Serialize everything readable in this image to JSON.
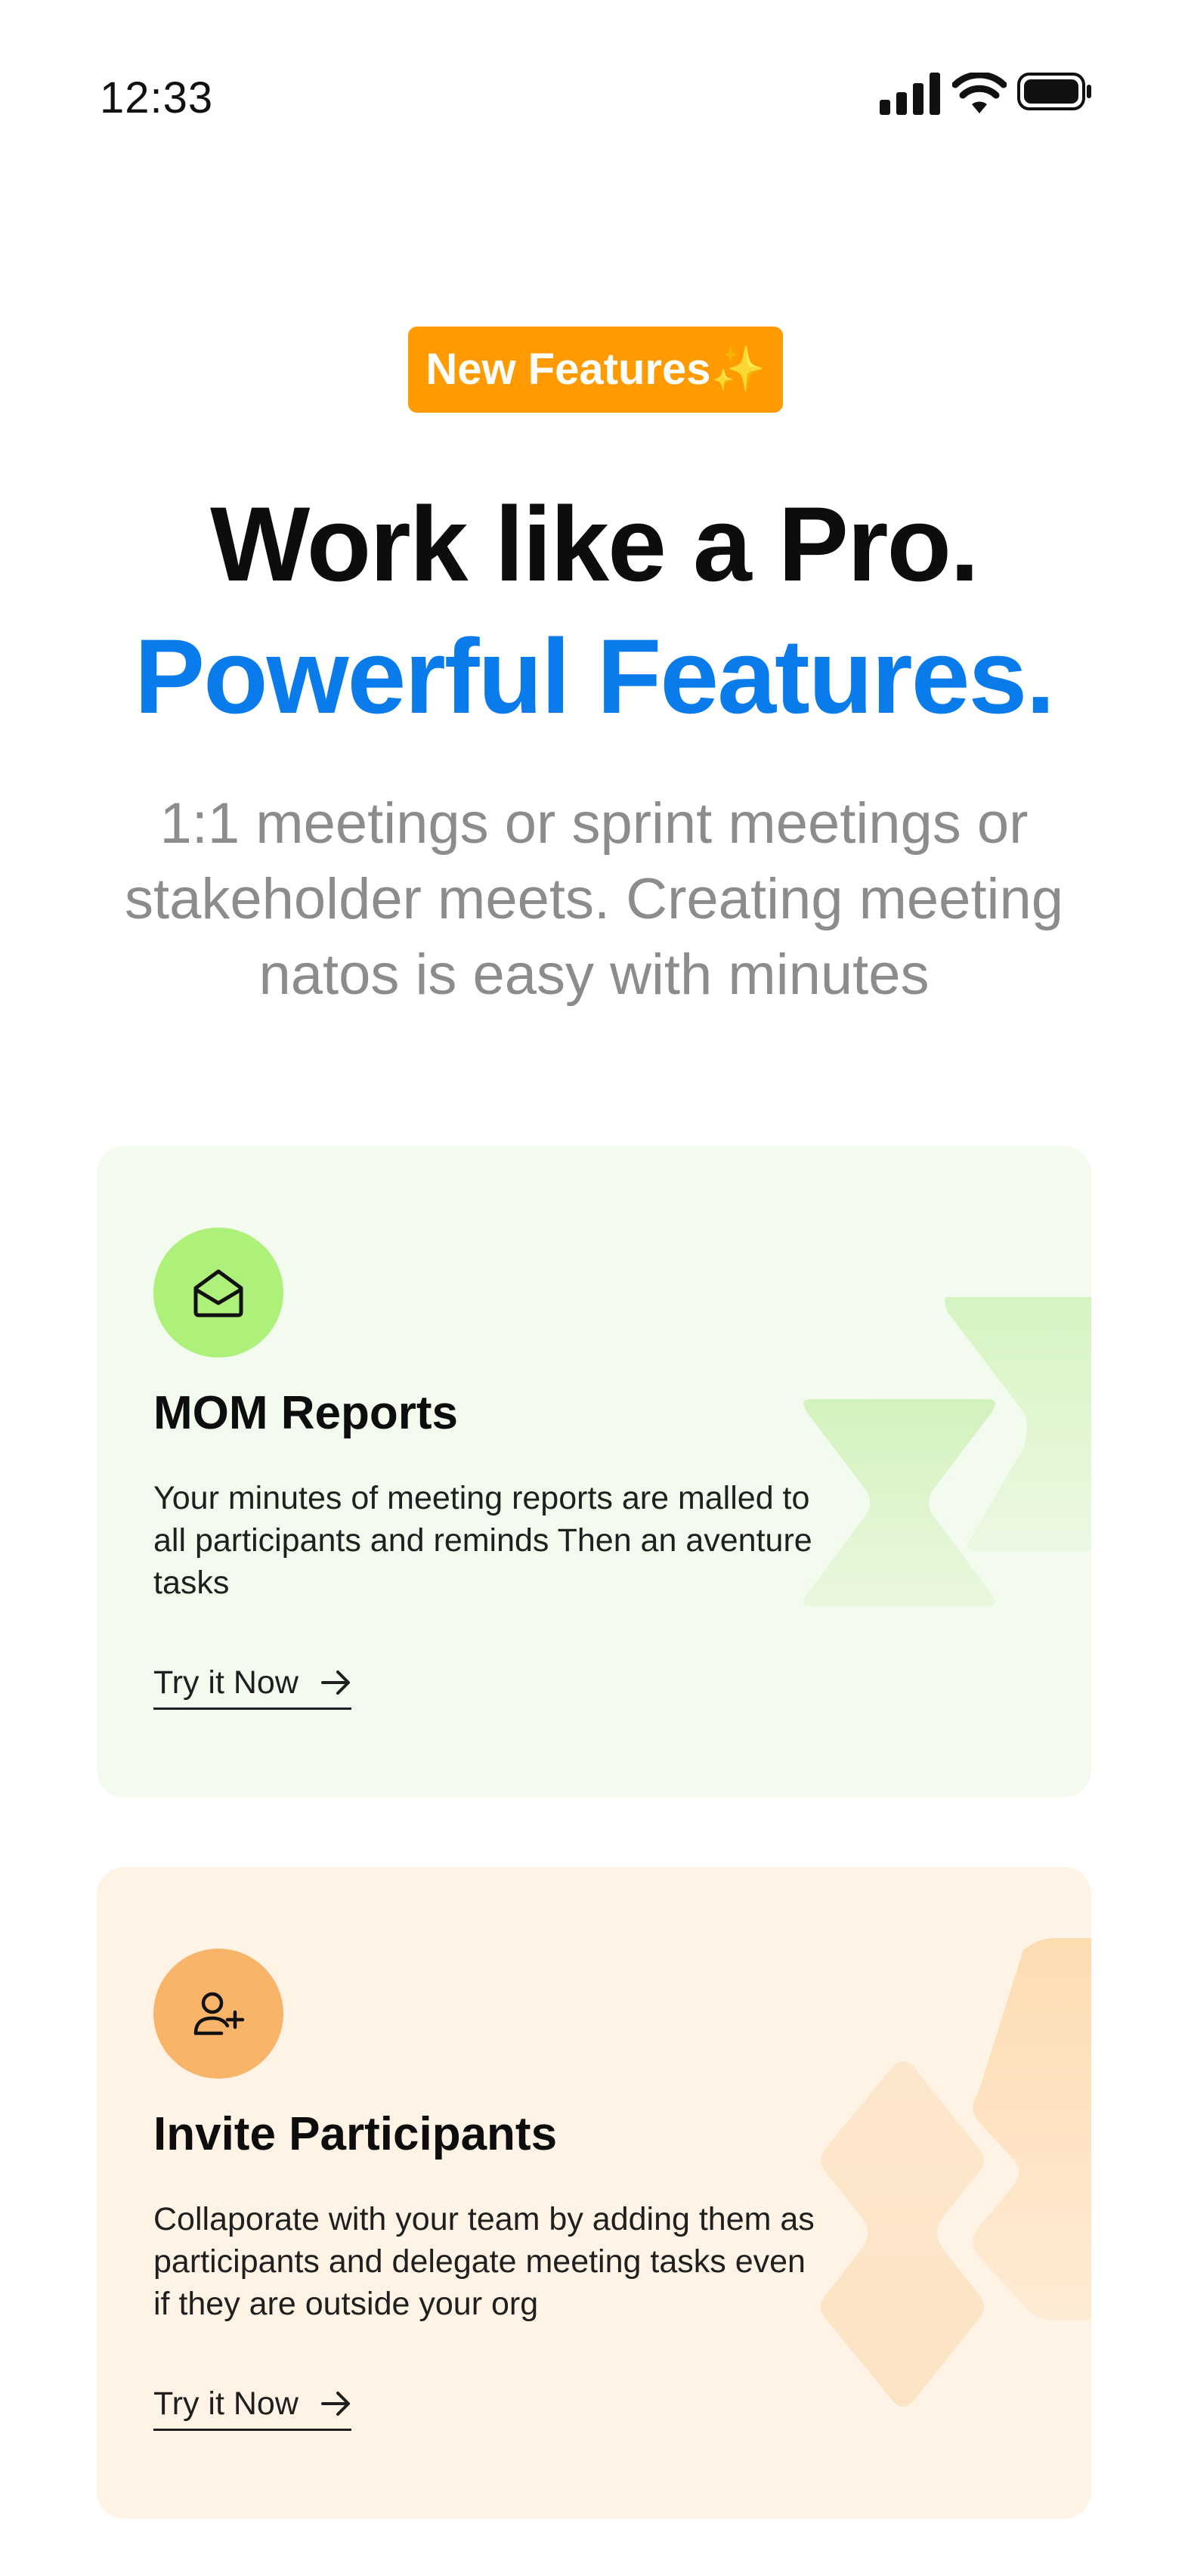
{
  "status_bar": {
    "time": "12:33",
    "icons": [
      "signal-icon",
      "wifi-icon",
      "battery-icon"
    ]
  },
  "hero": {
    "badge": "New Features",
    "badge_sparkle": "✨",
    "title": "Work like a Pro.",
    "subtitle": "Powerful Features.",
    "description": "1:1 meetings or sprint meetings or stakeholder meets. Creating meeting natos is easy with minutes"
  },
  "cards": {
    "mom": {
      "icon": "envelope-open-icon",
      "title": "MOM Reports",
      "description": "Your minutes of meeting reports are malled to all participants and reminds Then an aventure tasks",
      "link_label": "Try it Now"
    },
    "invite": {
      "icon": "user-plus-icon",
      "title": "Invite Participants",
      "description": "Collaporate with your team by adding them as participants and delegate meeting tasks even if they are outside your org",
      "link_label": "Try it Now"
    }
  },
  "colors": {
    "badge_bg": "#FF9A00",
    "accent_blue": "#0A7BEB",
    "mom_card_bg": "#F3FAEE",
    "mom_icon_bg": "#ADF07A",
    "invite_card_bg": "#FEF3E5",
    "invite_icon_bg": "#F8B56A",
    "description_gray": "#8C8C8C"
  }
}
